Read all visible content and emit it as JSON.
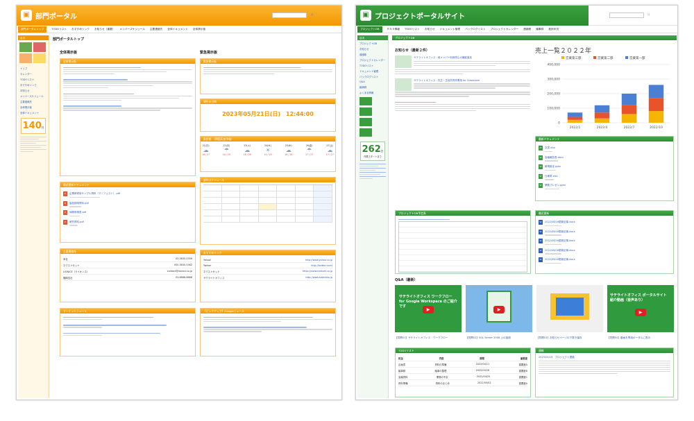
{
  "left": {
    "title": "部門ポータル",
    "nav": [
      "部門ポータルトップ",
      "TODOリスト",
      "おすすめリンク",
      "お知らせ（重要）",
      "メンバースケジュール",
      "主要連絡先",
      "全体ドキュメント",
      "全体掲示板"
    ],
    "side_head": "目次",
    "side_links": [
      "トップ",
      "カレンダー",
      "TODOリスト",
      "おすすめリンク",
      "お知らせ",
      "メンバースケジュール",
      "主要連絡先",
      "全体掲示板",
      "全体ドキュメント"
    ],
    "counter": "140",
    "counter_unit": "日",
    "page_title": "部門ポータルトップ",
    "bbs_title": "全体掲示板",
    "urgent_title": "緊急掲示板",
    "panels": {
      "bbs": "全体掲示板",
      "docs": "最近更新ドキュメント",
      "contacts": "主要連絡先",
      "market": "マーケットニュース",
      "urgent": "緊急掲示板",
      "clock": "現在の日時",
      "weather": "東京都　（四国天気予報）",
      "schedule": "部内スケジュール",
      "links": "おすすめリンク",
      "news": "【ピックアップ】Googleニュース"
    },
    "clock_text": "2023年05月21日(日)　12:44:00",
    "weather": [
      {
        "day": "21(日)",
        "t": "16 / 27"
      },
      {
        "day": "22(月)",
        "t": "16 / 25"
      },
      {
        "day": "23(火)",
        "t": "18 / 26"
      },
      {
        "day": "24(水)",
        "t": "14 / 24"
      },
      {
        "day": "25(木)",
        "t": "16 / 28"
      },
      {
        "day": "26(金)",
        "t": "17 / 27"
      },
      {
        "day": "27(土)",
        "t": "17 / 27"
      }
    ],
    "contacts": [
      [
        "本社",
        "03-5835-5356"
      ],
      [
        "ネクストセット",
        "050-5835-5362"
      ],
      [
        "LIONICE（ライオンス）",
        "contact@lionice.co.jp"
      ],
      [
        "福岡支社",
        "03-8888-8888"
      ]
    ],
    "links": [
      [
        "Yahoo!",
        "http://www.yahoo.co.jp"
      ],
      [
        "Twitter",
        "http://twitter.com/"
      ],
      [
        "ネクストセット",
        "https://www.nextset.co.jp"
      ],
      [
        "サテライトオフィス",
        "http://www.sateraito.jp"
      ]
    ],
    "docs": [
      "企業研修用サンプル資料（マニフェスト）.pdf",
      "製品説明資料.pdf",
      "休暇申請書.pdf",
      "研究資料.pdf"
    ]
  },
  "right": {
    "title": "プロジェクトポータルサイト",
    "nav": [
      "プロジェクトDB",
      "ＲＳＳ情報",
      "TODOリスト",
      "お知らせ",
      "ドキュメント管理",
      "バックログリスト",
      "プロジェクトカレンダー",
      "連絡帳",
      "議事録",
      "進捗状況"
    ],
    "side_head": "目次",
    "side_links": [
      "プロジェクトDB",
      "お知らせ",
      "連絡帳",
      "プロジェクトカレンダー",
      "TODOリスト",
      "ドキュメント管理",
      "バックログリスト",
      "Q&A",
      "議事録",
      "よくある情報"
    ],
    "counter": "262",
    "counter_unit": "日",
    "counter_caption": "作業スタートまで",
    "section_db": "プロジェクトDB",
    "notice_title": "お知らせ（最新２件）",
    "notice_links": [
      "サテライトオフィス・他メンバー利用停止の機能追加",
      "サテライトオフィス・先生・生徒共同作業用 for Classroom"
    ],
    "sales_title": "売上一覧２０２２年",
    "chart_data": {
      "type": "bar",
      "title": "売上一覧２０２２年",
      "categories": [
        "2022/1",
        "2022/4",
        "2022/7",
        "2022/10"
      ],
      "series": [
        {
          "name": "営業第三部",
          "values": [
            20000,
            30000,
            60000,
            80000
          ]
        },
        {
          "name": "営業第二部",
          "values": [
            20000,
            40000,
            60000,
            90000
          ]
        },
        {
          "name": "営業第一部",
          "values": [
            30000,
            50000,
            80000,
            90000
          ]
        }
      ],
      "ylim": [
        0,
        400000
      ],
      "yticks": [
        "0",
        "100,000",
        "200,000",
        "300,000",
        "400,000"
      ],
      "colors": {
        "営業第三部": "#f5b400",
        "営業第二部": "#e8532c",
        "営業第一部": "#4a7fd4"
      }
    },
    "panels": {
      "recent_docs": "最新ドキュメント",
      "recent_posts": "最近更新",
      "schedule": "プロジェクトDB予定表",
      "qa": "Q&A（最新）",
      "todo": "TODOリスト",
      "contact": "連絡"
    },
    "doc_links": [
      "文書.xlsx",
      "会議報告書.docx",
      "新規設定.pptx",
      "仕様書.xlsx",
      "業務プレゼン.pptx"
    ],
    "post_links": [
      "2022/08/16更新記事.docx",
      "2022/08/16更新記事.docx",
      "2022/08/16更新記事.docx",
      "2022/08/16更新記事.docx",
      "2022/08/16更新記事.docx"
    ],
    "qa_captions": [
      "【質問01】サテライトオフィス・ワークフロー",
      "【質問02】SQL Server 2008 上の接続",
      "【質問03】お知らせページの下書き保存",
      "【質問04】動画を専用ポータルに表示"
    ],
    "thumb_title": "サテライトオフィス ワークフロー for Google Workspace のご紹介です",
    "thumb_title2": "サテライトオフィス ポータルサイト 紹介動画（音声あり）",
    "todo_headers": [
      "担当",
      "内容",
      "期限",
      "重要度"
    ],
    "todo_rows": [
      [
        "企画書",
        "資料の準備",
        "2022/04/11",
        "重要度A"
      ],
      [
        "議事録",
        "議事の整理",
        "2022/04/18",
        "重要度B"
      ],
      [
        "会議資料",
        "業務の予定",
        "2022/04/25",
        "重要度C"
      ],
      [
        "資料準備",
        "資料のまとめ",
        "2022/05/02",
        "重要度A"
      ]
    ],
    "contact_heading": "2023/04/19　プロジェクト連絡"
  }
}
